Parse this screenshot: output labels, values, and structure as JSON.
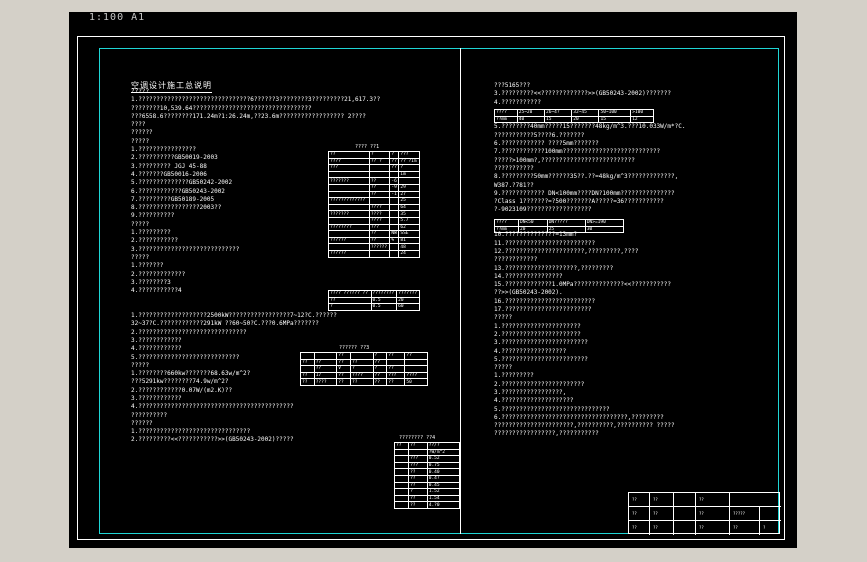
{
  "viewport": {
    "zoom_label": "1:100  A1"
  },
  "left_column": {
    "title": "空调设计施工总说明",
    "lines": [
      "?????",
      "1.???????????????????????????????6??????3????????3?????????21,617.3??",
      "????????10,539.64?????????????????????????????????",
      "???6558.6????????171.24m?1:26.24m,??23.6m?????????????????? 2????",
      "????",
      "??????",
      "?????",
      "1.????????????????",
      "2.??????????GB50019-2003",
      "3.????????? JGJ 45-88",
      "4.???????GB50016-2006",
      "5.??????????????GB50242-2002",
      "6.????????????GB50243-2002",
      "7.?????????GB50189-2005",
      "8.?????????????????2003??",
      "9.??????????",
      "?????",
      "1.?????????",
      "2.???????????",
      "3.????????????????????????????",
      "?????",
      "1.???????",
      "2.?????????????",
      "3.????????3",
      "4.???????????4",
      "",
      "",
      "1.???????????????????2500kW?????????????????7~12?C.??????",
      "32~37?C.????????????291kW ??60~50?C.???0.6MPa???????",
      "2.??????????????????????????????",
      "3.????????????",
      "4.????????????",
      "5.????????????????????????????",
      "?????",
      "1.????????660kw???????68.63w/m^2?",
      "???5291kw????????74.9w/m^2?",
      "2.????????????0.07W/(m2.K)??",
      "3.????????????",
      "4.???????????????????????????????????????????",
      "??????????",
      "??????",
      "1.???????????????????????????????",
      "2.?????????<<???????????>>(GB50243-2002)?????"
    ]
  },
  "right_column": {
    "lines": [
      "???5165???",
      "3.?????????<<?????????????>>(GB50243-2002)???????",
      "4.???????????",
      "",
      "",
      "5.????????40mm?????15???????48kg/m^3.???10.033W/m*?C.",
      "???????????5????6.???????",
      "6.???????????? ????5mm???????",
      "7.????????????100mm???????????????????????????",
      "?????>100mm?,??????????????????????????",
      "???????????",
      "8.?????????50mm??????35??.??=48kg/m^3?????????????,",
      "W387.?781??",
      "9.???????????? DN<100mm????DN?100mm???????????????",
      "?Class 1???????=?500???????A?????=36???????????",
      "?-9023109??????????????????",
      "",
      "",
      "10.??????????????=13mm?",
      "11.?????????????????????????",
      "12.??????????????????????,?????????,????",
      "????????????",
      "13.????????????????????,?????????",
      "14.????????????????",
      "15.?????????????1.0MPa??????????????<<???????????",
      "??>>(GB50243-2002).",
      "16.?????????????????????????",
      "17.????????????????????????",
      "?????",
      "1.??????????????????????",
      "2.??????????????????????",
      "3.????????????????????????",
      "4.??????????????????",
      "5.????????????????????????",
      "?????",
      "1.?????????",
      "2.???????????????????????",
      "3.?????????????????,",
      "4.????????????????????",
      "5.??????????????????????????????",
      "6.???????????????????????????????????,?????????",
      "??????????????????????,??????????,?????????? ?????",
      "?????????????????,???????????"
    ]
  },
  "table1": {
    "caption": "???? ??1",
    "rows": [
      [
        "??",
        "?",
        "?",
        "???"
      ],
      [
        "????",
        "?? ?",
        "??",
        "?? ?Im"
      ],
      [
        "???",
        "",
        "??",
        "?"
      ],
      [
        "",
        "",
        "",
        "Im"
      ],
      [
        "???????",
        "??",
        "-6",
        ""
      ],
      [
        "",
        "??",
        "-9",
        "29"
      ],
      [
        "",
        "??",
        "-1",
        "27"
      ],
      [
        "?????????????",
        "",
        "",
        "25"
      ],
      [
        "",
        "????",
        "",
        "64"
      ],
      [
        "???????",
        "????",
        "",
        "35"
      ],
      [
        "",
        "????",
        "",
        "5.7"
      ],
      [
        "????????",
        "???",
        "",
        "62"
      ],
      [
        "",
        "??",
        "NW",
        "SSE"
      ],
      [
        "??????",
        "??",
        "%",
        "81"
      ],
      [
        "",
        "??????",
        "",
        "48"
      ],
      [
        "??????",
        "",
        "",
        "24"
      ]
    ]
  },
  "table2": {
    "rows": [
      [
        "???? ?????? ??",
        "????????",
        "???????"
      ],
      [
        "??",
        "0.5",
        "20"
      ],
      [
        "?",
        "0.5",
        "60"
      ]
    ]
  },
  "table3": {
    "caption": "?????? ??3",
    "rows": [
      [
        "",
        "",
        "??",
        "",
        "?",
        "??",
        "??"
      ],
      [
        "??",
        "??",
        "??",
        "??",
        "??",
        "",
        ""
      ],
      [
        "",
        "??",
        "V",
        "?",
        "?",
        "??",
        ""
      ],
      [
        "??",
        "17",
        "??",
        "????",
        "??",
        "???",
        "????"
      ],
      [
        "??",
        "????",
        "??",
        "??",
        "??",
        "??",
        "50"
      ]
    ]
  },
  "table4": {
    "rows": [
      [
        "????",
        "25~20",
        "26~4?",
        "32~45",
        "50~100",
        ">100"
      ],
      [
        "??mm",
        "40",
        "15",
        "20",
        "15",
        "12"
      ]
    ]
  },
  "table5": {
    "rows": [
      [
        "????",
        "DN<50",
        "DN?????",
        "DN>=190"
      ],
      [
        "??mm",
        "20",
        "25",
        "30"
      ]
    ]
  },
  "table6": {
    "caption": "???????? ??4",
    "rows": [
      [
        "??",
        "??",
        "??/?"
      ],
      [
        "",
        "",
        "?W/m^2"
      ],
      [
        "",
        "???",
        "0.52"
      ],
      [
        "",
        "???",
        "0.75"
      ],
      [
        "",
        "??",
        "0.40"
      ],
      [
        "",
        "??",
        "0.4?"
      ],
      [
        "",
        "??",
        "0.45"
      ],
      [
        "",
        "?",
        "1.52"
      ],
      [
        "",
        "??",
        "1.54"
      ],
      [
        "",
        "??",
        "4.?0"
      ]
    ]
  },
  "title_block": {
    "labels": [
      "??",
      "??",
      "??",
      "??",
      "??",
      "??",
      "?????",
      "??",
      "??",
      "??",
      "??",
      "?"
    ]
  },
  "colors": {
    "inner_border": "#1fd5d5",
    "background": "#000000",
    "ink": "#ffffff"
  }
}
